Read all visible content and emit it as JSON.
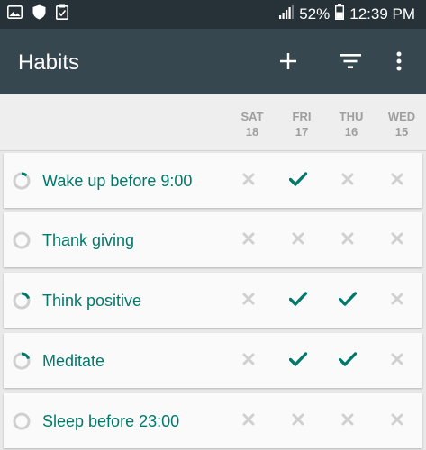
{
  "status_bar": {
    "battery_percent": "52%",
    "time": "12:39 PM",
    "left_icons": [
      "image-icon",
      "shield-icon",
      "checklist-icon"
    ],
    "right_icons": [
      "signal-icon",
      "battery-icon"
    ]
  },
  "app_bar": {
    "title": "Habits",
    "actions": [
      "add-icon",
      "filter-icon",
      "overflow-menu-icon"
    ]
  },
  "days": [
    {
      "weekday": "SAT",
      "date": "18"
    },
    {
      "weekday": "FRI",
      "date": "17"
    },
    {
      "weekday": "THU",
      "date": "16"
    },
    {
      "weekday": "WED",
      "date": "15"
    }
  ],
  "habits": [
    {
      "name": "Wake up before 9:00",
      "score": 0.12,
      "checks": [
        false,
        true,
        false,
        false
      ]
    },
    {
      "name": "Thank giving",
      "score": 0,
      "checks": [
        false,
        false,
        false,
        false
      ]
    },
    {
      "name": "Think positive",
      "score": 0.2,
      "checks": [
        false,
        true,
        true,
        false
      ]
    },
    {
      "name": "Meditate",
      "score": 0.2,
      "checks": [
        false,
        true,
        true,
        false
      ]
    },
    {
      "name": "Sleep before 23:00",
      "score": 0,
      "checks": [
        false,
        false,
        false,
        false
      ]
    }
  ],
  "colors": {
    "status_bar": "#263238",
    "app_bar": "#37474f",
    "accent": "#00796b",
    "inactive": "#d0d0d0"
  }
}
